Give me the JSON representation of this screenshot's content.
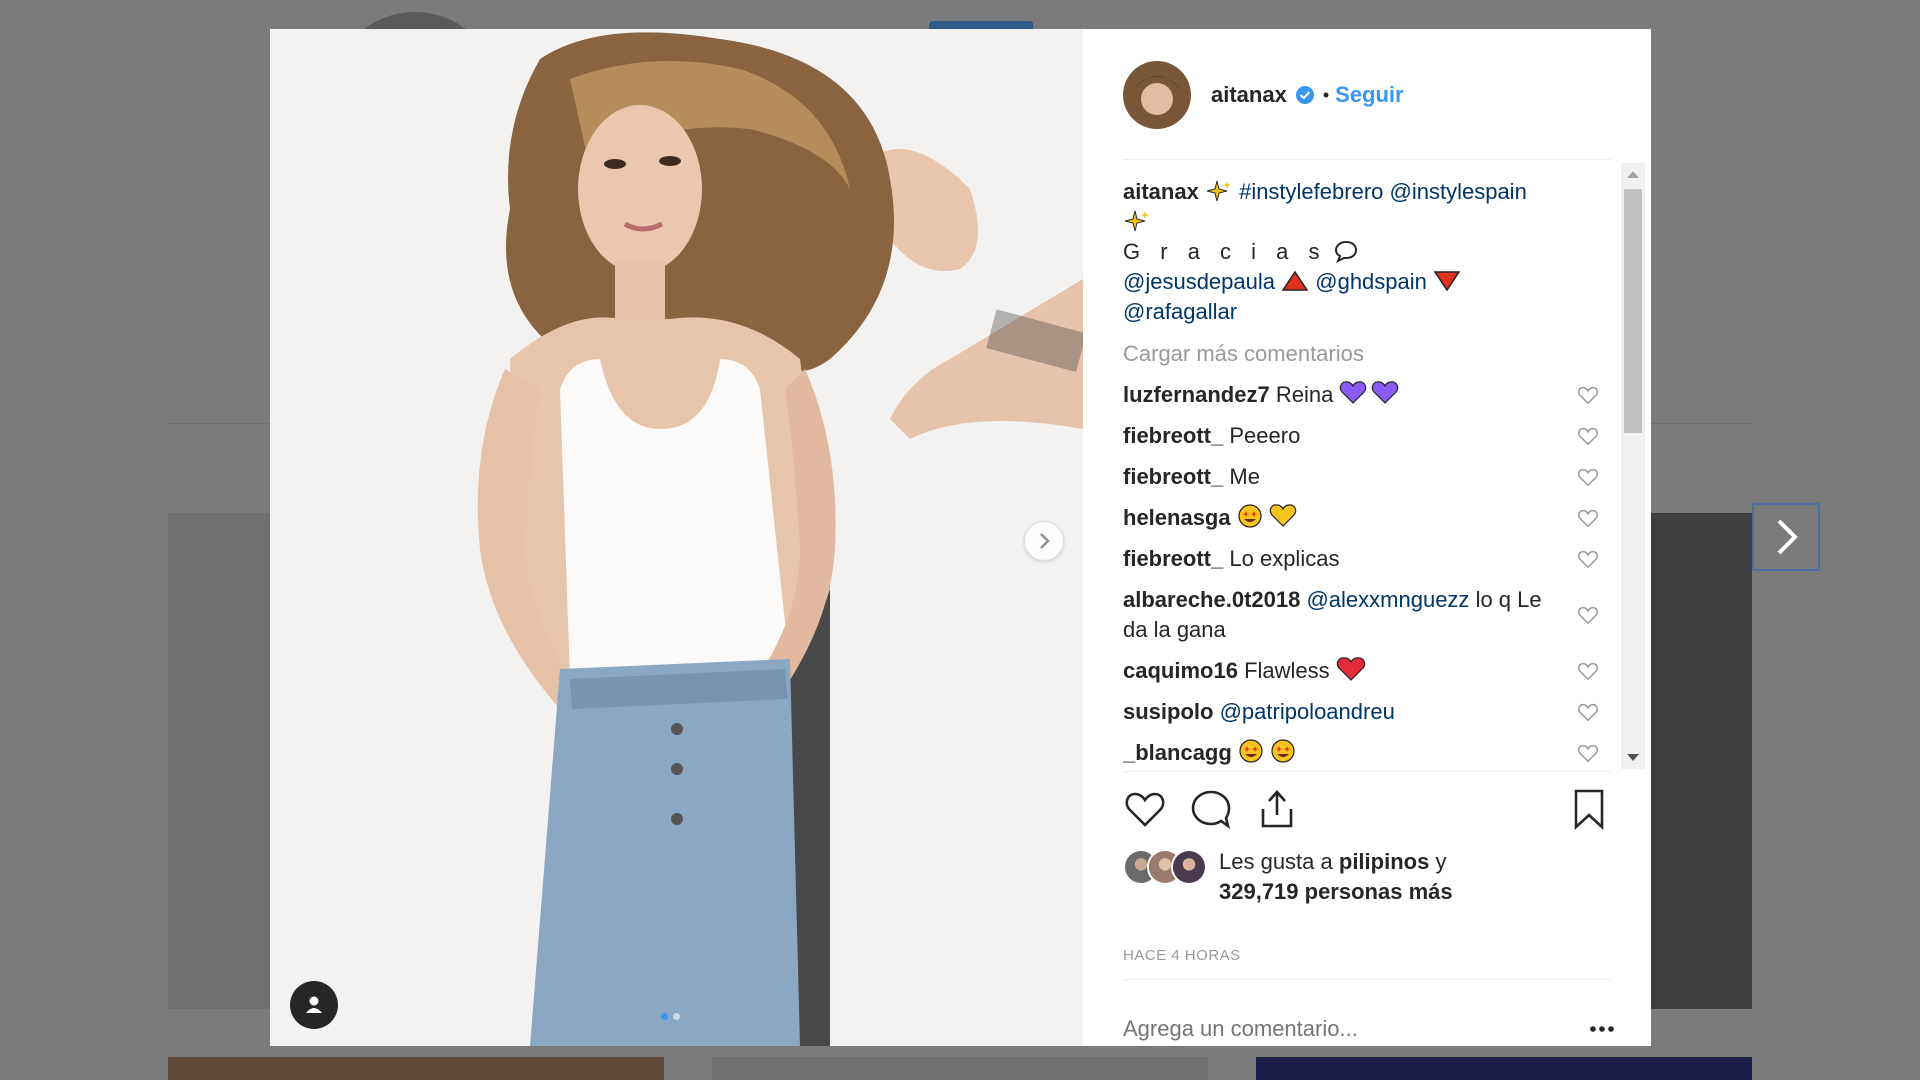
{
  "post": {
    "username": "aitanax",
    "separator": "•",
    "follow_label": "Seguir",
    "caption": {
      "username": "aitanax",
      "hashtag": "#instylefebrero",
      "mention_1": "@instylespain",
      "thanks": "G r a c i a s",
      "mention_2": "@jesusdepaula",
      "mention_3": "@ghdspain",
      "mention_4": "@rafagallar"
    },
    "load_more_label": "Cargar más comentarios",
    "comments": [
      {
        "user": "luzfernandez7",
        "text": "Reina",
        "emoji": "purple-hearts"
      },
      {
        "user": "fiebreott_",
        "text": "Peeero"
      },
      {
        "user": "fiebreott_",
        "text": "Me"
      },
      {
        "user": "helenasga",
        "text": "",
        "emoji": "star-eyes-yellow-heart"
      },
      {
        "user": "fiebreott_",
        "text": "Lo explicas"
      },
      {
        "user": "albareche.0t2018",
        "mention": "@alexxmnguezz",
        "text": "lo q Le da la gana"
      },
      {
        "user": "caquimo16",
        "text": "Flawless",
        "emoji": "red-heart"
      },
      {
        "user": "susipolo",
        "mention": "@patripoloandreu",
        "text": ""
      },
      {
        "user": "_blancagg",
        "text": "",
        "emoji": "star-eyes-double"
      }
    ],
    "likes": {
      "prefix": "Les gusta a",
      "liker": "pilipinos",
      "connector": "y",
      "count_text": "329,719 personas más"
    },
    "timestamp": "HACE 4 HORAS",
    "comment_placeholder": "Agrega un comentario...",
    "more_label": "•••"
  },
  "icons": {
    "verified": "verified-badge-icon",
    "like": "heart-outline-icon",
    "comment": "speech-bubble-icon",
    "share": "share-upload-icon",
    "save": "bookmark-icon",
    "next": "chevron-right-icon",
    "tag": "user-tag-icon"
  },
  "colors": {
    "link": "#003569",
    "follow": "#3897f0",
    "muted": "#999999",
    "text": "#262626",
    "overlay": "#7b7b7b"
  }
}
